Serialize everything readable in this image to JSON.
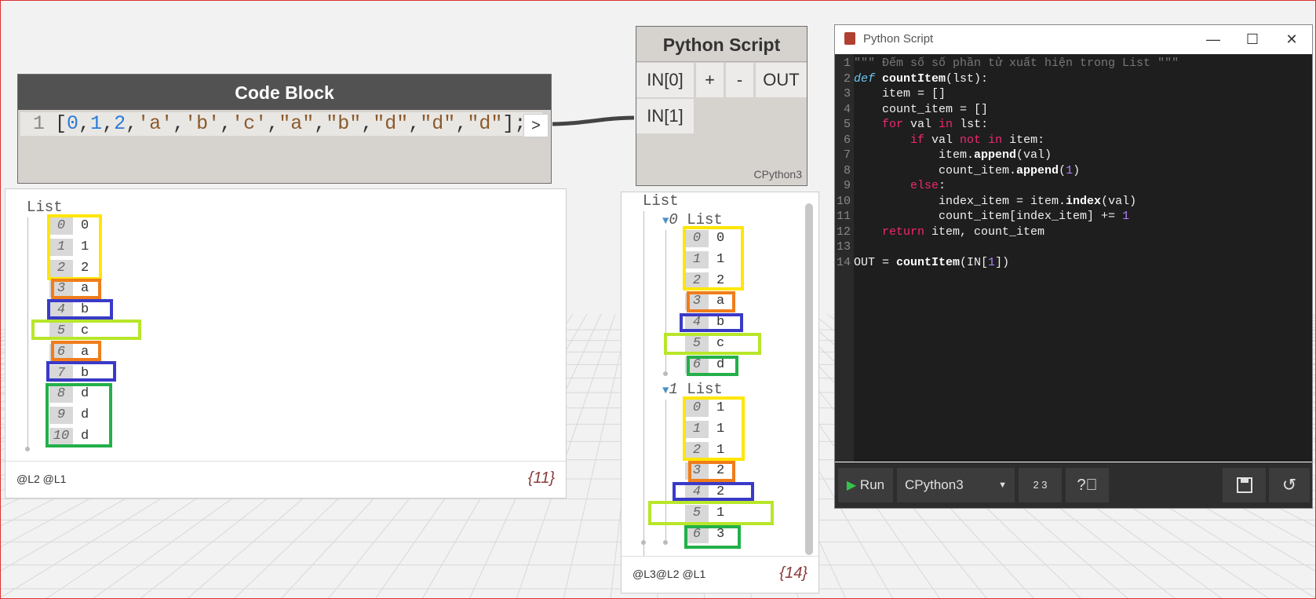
{
  "code_block": {
    "title": "Code Block",
    "line_number": "1",
    "tokens": [
      {
        "t": "[",
        "c": ""
      },
      {
        "t": "0",
        "c": "num"
      },
      {
        "t": ",",
        "c": ""
      },
      {
        "t": "1",
        "c": "num"
      },
      {
        "t": ",",
        "c": ""
      },
      {
        "t": "2",
        "c": "num"
      },
      {
        "t": ",",
        "c": ""
      },
      {
        "t": "'a'",
        "c": "str"
      },
      {
        "t": ",",
        "c": ""
      },
      {
        "t": "'b'",
        "c": "str"
      },
      {
        "t": ",",
        "c": ""
      },
      {
        "t": "'c'",
        "c": "str"
      },
      {
        "t": ",",
        "c": ""
      },
      {
        "t": "\"a\"",
        "c": "str"
      },
      {
        "t": ",",
        "c": ""
      },
      {
        "t": "\"b\"",
        "c": "str"
      },
      {
        "t": ",",
        "c": ""
      },
      {
        "t": "\"d\"",
        "c": "str"
      },
      {
        "t": ",",
        "c": ""
      },
      {
        "t": "\"d\"",
        "c": "str"
      },
      {
        "t": ",",
        "c": ""
      },
      {
        "t": "\"d\"",
        "c": "str"
      },
      {
        "t": "];",
        "c": ""
      }
    ],
    "output_port": ">"
  },
  "python_node": {
    "title": "Python Script",
    "in0": "IN[0]",
    "in1": "IN[1]",
    "plus": "+",
    "minus": "-",
    "out": "OUT",
    "engine": "CPython3"
  },
  "watch_left": {
    "root_label": "List",
    "items": [
      {
        "i": "0",
        "v": "0"
      },
      {
        "i": "1",
        "v": "1"
      },
      {
        "i": "2",
        "v": "2"
      },
      {
        "i": "3",
        "v": "a"
      },
      {
        "i": "4",
        "v": "b"
      },
      {
        "i": "5",
        "v": "c"
      },
      {
        "i": "6",
        "v": "a"
      },
      {
        "i": "7",
        "v": "b"
      },
      {
        "i": "8",
        "v": "d"
      },
      {
        "i": "9",
        "v": "d"
      },
      {
        "i": "10",
        "v": "d"
      }
    ],
    "levels": "@L2 @L1",
    "count": "{11}"
  },
  "watch_right": {
    "root_label": "List",
    "sub0_index": "0",
    "sub0_label": "List",
    "sub0_items": [
      {
        "i": "0",
        "v": "0"
      },
      {
        "i": "1",
        "v": "1"
      },
      {
        "i": "2",
        "v": "2"
      },
      {
        "i": "3",
        "v": "a"
      },
      {
        "i": "4",
        "v": "b"
      },
      {
        "i": "5",
        "v": "c"
      },
      {
        "i": "6",
        "v": "d"
      }
    ],
    "sub1_index": "1",
    "sub1_label": "List",
    "sub1_items": [
      {
        "i": "0",
        "v": "1"
      },
      {
        "i": "1",
        "v": "1"
      },
      {
        "i": "2",
        "v": "1"
      },
      {
        "i": "3",
        "v": "2"
      },
      {
        "i": "4",
        "v": "2"
      },
      {
        "i": "5",
        "v": "1"
      },
      {
        "i": "6",
        "v": "3"
      }
    ],
    "levels": "@L3@L2 @L1",
    "count": "{14}"
  },
  "highlight_colors": {
    "yellow": "#ffe600",
    "orange": "#f07d1a",
    "blue": "#3a3ac8",
    "lime": "#b8e62a",
    "green": "#22b04a"
  },
  "editor": {
    "title": "Python Script",
    "minimize": "—",
    "maximize": "☐",
    "close": "✕",
    "lines": [
      [
        {
          "t": "\"\"\" Đếm số số phần tử xuất hiện trong List \"\"\"",
          "c": "cmt"
        }
      ],
      [
        {
          "t": "def",
          "c": "def"
        },
        {
          "t": " ",
          "c": ""
        },
        {
          "t": "countItem",
          "c": "fn"
        },
        {
          "t": "(lst):",
          "c": ""
        }
      ],
      [
        {
          "t": "    item = []",
          "c": ""
        }
      ],
      [
        {
          "t": "    count_item = []",
          "c": ""
        }
      ],
      [
        {
          "t": "    ",
          "c": ""
        },
        {
          "t": "for",
          "c": "kw"
        },
        {
          "t": " val ",
          "c": ""
        },
        {
          "t": "in",
          "c": "kw"
        },
        {
          "t": " lst:",
          "c": ""
        }
      ],
      [
        {
          "t": "        ",
          "c": ""
        },
        {
          "t": "if",
          "c": "kw"
        },
        {
          "t": " val ",
          "c": ""
        },
        {
          "t": "not",
          "c": "kw"
        },
        {
          "t": " ",
          "c": ""
        },
        {
          "t": "in",
          "c": "kw"
        },
        {
          "t": " item:",
          "c": ""
        }
      ],
      [
        {
          "t": "            item.",
          "c": ""
        },
        {
          "t": "append",
          "c": "fn"
        },
        {
          "t": "(val)",
          "c": ""
        }
      ],
      [
        {
          "t": "            count_item.",
          "c": ""
        },
        {
          "t": "append",
          "c": "fn"
        },
        {
          "t": "(",
          "c": ""
        },
        {
          "t": "1",
          "c": "num"
        },
        {
          "t": ")",
          "c": ""
        }
      ],
      [
        {
          "t": "        ",
          "c": ""
        },
        {
          "t": "else",
          "c": "kw"
        },
        {
          "t": ":",
          "c": ""
        }
      ],
      [
        {
          "t": "            index_item = item.",
          "c": ""
        },
        {
          "t": "index",
          "c": "fn"
        },
        {
          "t": "(val)",
          "c": ""
        }
      ],
      [
        {
          "t": "            count_item[index_item] += ",
          "c": ""
        },
        {
          "t": "1",
          "c": "num"
        }
      ],
      [
        {
          "t": "    ",
          "c": ""
        },
        {
          "t": "return",
          "c": "kw"
        },
        {
          "t": " item, count_item",
          "c": ""
        }
      ],
      [
        {
          "t": "",
          "c": ""
        }
      ],
      [
        {
          "t": "OUT = ",
          "c": ""
        },
        {
          "t": "countItem",
          "c": "fn"
        },
        {
          "t": "(IN[",
          "c": ""
        },
        {
          "t": "1",
          "c": "num"
        },
        {
          "t": "])",
          "c": ""
        }
      ]
    ],
    "toolbar": {
      "run_label": "Run",
      "engine_value": "CPython3",
      "rename_icon_text": "2 3"
    }
  }
}
